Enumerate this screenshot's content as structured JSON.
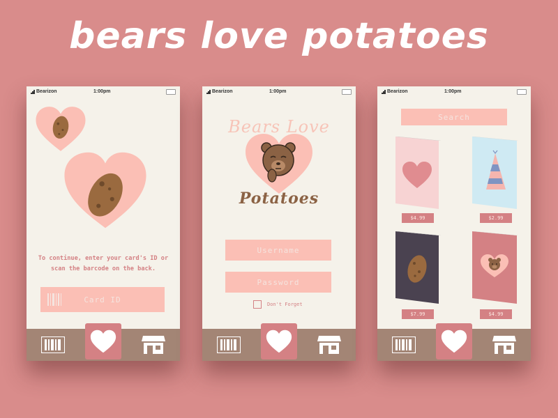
{
  "headline": "bears love potatoes",
  "status": {
    "carrier": "Bearizon",
    "time": "1:00pm"
  },
  "screen1": {
    "instruction_line1": "To continue, enter your card's ID or",
    "instruction_line2": "scan the barcode on the back.",
    "card_id_placeholder": "Card ID"
  },
  "screen2": {
    "logo_top": "Bears Love",
    "logo_bottom": "Potatoes",
    "username_placeholder": "Username",
    "password_placeholder": "Password",
    "remember_label": "Don't Forget"
  },
  "screen3": {
    "search_placeholder": "Search",
    "cards": [
      {
        "name": "heart card",
        "price": "$4.99"
      },
      {
        "name": "party hat card",
        "price": "$2.99"
      },
      {
        "name": "potato card",
        "price": "$7.99"
      },
      {
        "name": "bear card",
        "price": "$4.99"
      }
    ]
  },
  "tabs": [
    "barcode-icon",
    "heart-icon",
    "store-icon"
  ],
  "colors": {
    "background": "#d98c8b",
    "screen": "#f5f2ea",
    "pink": "#fbbfb5",
    "tabbar": "#a38575",
    "active_tab": "#d48184",
    "text": "#d48184"
  }
}
